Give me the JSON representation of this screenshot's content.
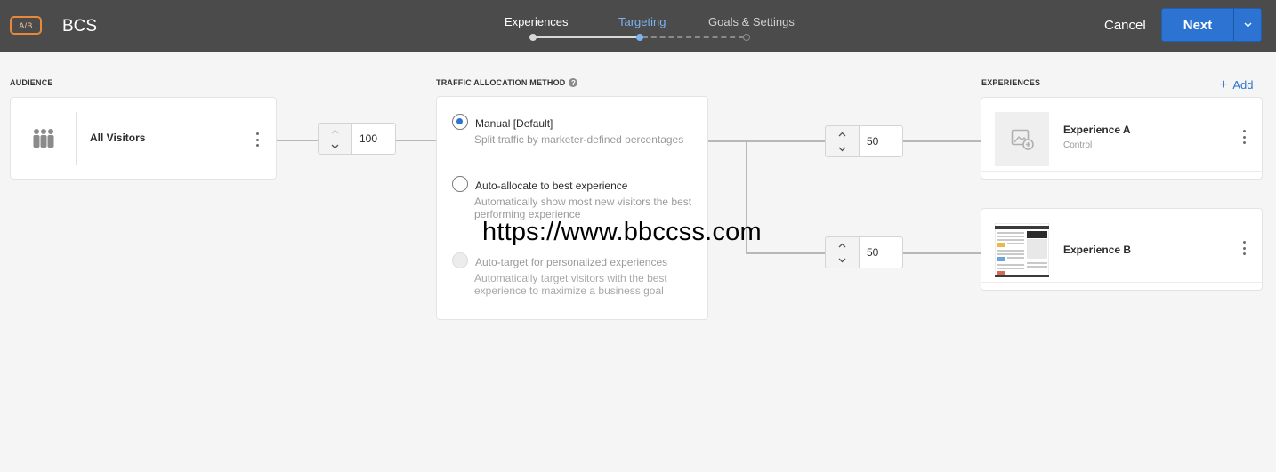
{
  "header": {
    "badge": "A/B",
    "title": "BCS",
    "steps": [
      "Experiences",
      "Targeting",
      "Goals & Settings"
    ],
    "active_step_color": "#7db3ef",
    "cancel_label": "Cancel",
    "next_label": "Next"
  },
  "audience": {
    "section_label": "AUDIENCE",
    "name": "All Visitors",
    "icon": "people-group-icon",
    "allocation": "100"
  },
  "traffic": {
    "section_label": "TRAFFIC ALLOCATION METHOD",
    "options": [
      {
        "title": "Manual [Default]",
        "description": "Split traffic by marketer-defined percentages",
        "selected": true,
        "enabled": true
      },
      {
        "title": "Auto-allocate to best experience",
        "description": "Automatically show most new visitors the best performing experience",
        "selected": false,
        "enabled": true
      },
      {
        "title": "Auto-target for personalized experiences",
        "description": "Automatically target visitors with the best experience to maximize a business goal",
        "selected": false,
        "enabled": false
      }
    ]
  },
  "experiences": {
    "section_label": "EXPERIENCES",
    "add_label": "Add",
    "items": [
      {
        "name": "Experience A",
        "subtitle": "Control",
        "allocation": "50"
      },
      {
        "name": "Experience B",
        "subtitle": "",
        "allocation": "50"
      }
    ]
  },
  "watermark": "https://www.bbccss.com",
  "colors": {
    "accent": "#2d73d1",
    "header_bg": "#4b4b4b",
    "badge_border": "#e8893a"
  }
}
